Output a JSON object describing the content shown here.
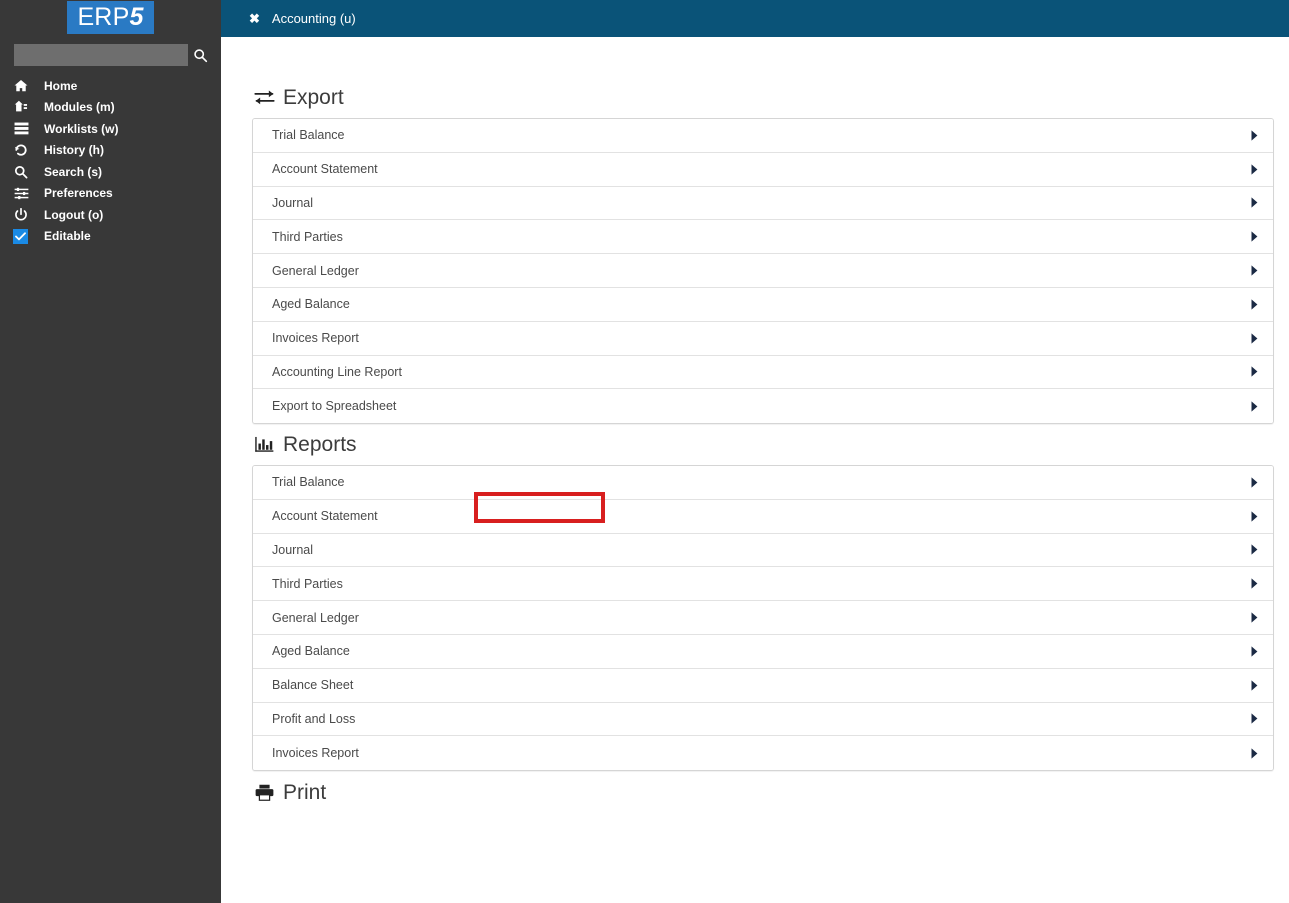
{
  "brand": {
    "logo_prefix": "ERP",
    "logo_suffix": "5",
    "logo_bg": "#2a7ac4"
  },
  "sidebar": {
    "bg": "#383838",
    "search": {
      "value": "",
      "placeholder": "",
      "icon": "search-icon"
    },
    "items": [
      {
        "label": "Home",
        "icon": "home-icon"
      },
      {
        "label": "Modules (m)",
        "icon": "modules-icon"
      },
      {
        "label": "Worklists (w)",
        "icon": "worklists-icon"
      },
      {
        "label": "History (h)",
        "icon": "history-icon"
      },
      {
        "label": "Search (s)",
        "icon": "search-icon"
      },
      {
        "label": "Preferences",
        "icon": "preferences-icon"
      },
      {
        "label": "Logout (o)",
        "icon": "power-icon"
      },
      {
        "label": "Editable",
        "icon": "checkbox-checked-icon",
        "checked": true
      }
    ]
  },
  "topbar": {
    "bg": "#0a5378",
    "tabs": [
      {
        "label": "Accounting (u)",
        "close_glyph": "✖",
        "active": true
      }
    ]
  },
  "main": {
    "sections": [
      {
        "id": "export",
        "title": "Export",
        "icon": "transfer-arrows-icon",
        "rows": [
          {
            "label": "Trial Balance"
          },
          {
            "label": "Account Statement"
          },
          {
            "label": "Journal"
          },
          {
            "label": "Third Parties"
          },
          {
            "label": "General Ledger"
          },
          {
            "label": "Aged Balance"
          },
          {
            "label": "Invoices Report"
          },
          {
            "label": "Accounting Line Report"
          },
          {
            "label": "Export to Spreadsheet"
          }
        ]
      },
      {
        "id": "reports",
        "title": "Reports",
        "icon": "bar-chart-icon",
        "rows": [
          {
            "label": "Trial Balance"
          },
          {
            "label": "Account Statement",
            "highlighted": true
          },
          {
            "label": "Journal"
          },
          {
            "label": "Third Parties"
          },
          {
            "label": "General Ledger"
          },
          {
            "label": "Aged Balance"
          },
          {
            "label": "Balance Sheet"
          },
          {
            "label": "Profit and Loss"
          },
          {
            "label": "Invoices Report"
          }
        ]
      },
      {
        "id": "print",
        "title": "Print",
        "icon": "printer-icon",
        "rows": []
      }
    ]
  },
  "annotation": {
    "color": "#d81f1f",
    "target_label": "Account Statement",
    "target_section": "reports"
  }
}
